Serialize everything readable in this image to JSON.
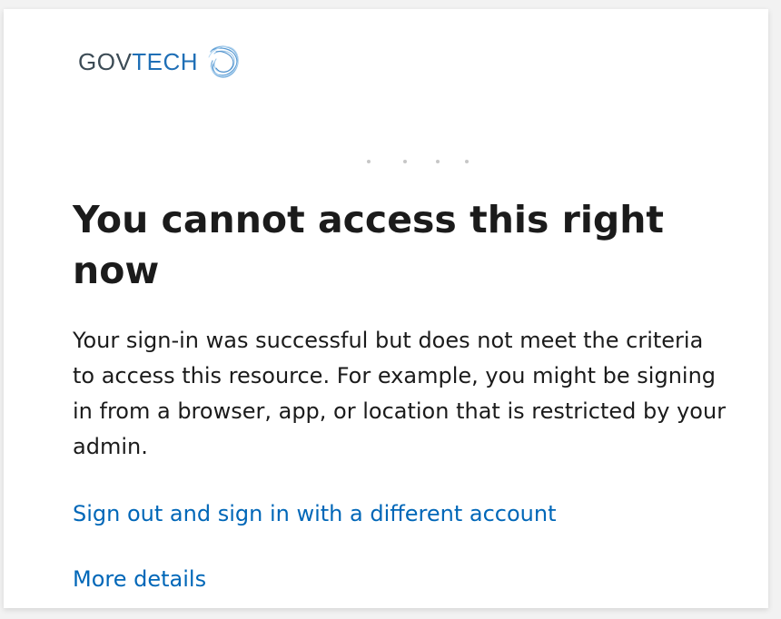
{
  "brand": {
    "name_part1": "GOV",
    "name_part2": "TECH",
    "logo_icon": "govtech-swirl-icon",
    "colors": {
      "gov": "#3c4b55",
      "tech": "#1f6fb6"
    }
  },
  "error": {
    "title": "You cannot access this right now",
    "description": "Your sign-in was successful but does not meet the criteria to access this resource. For example, you might be signing in from a browser, app, or location that is restricted by your admin."
  },
  "links": {
    "signout": "Sign out and sign in with a different account",
    "details": "More details"
  },
  "colors": {
    "link": "#0067b8",
    "text": "#1b1b1b",
    "background": "#ffffff"
  }
}
